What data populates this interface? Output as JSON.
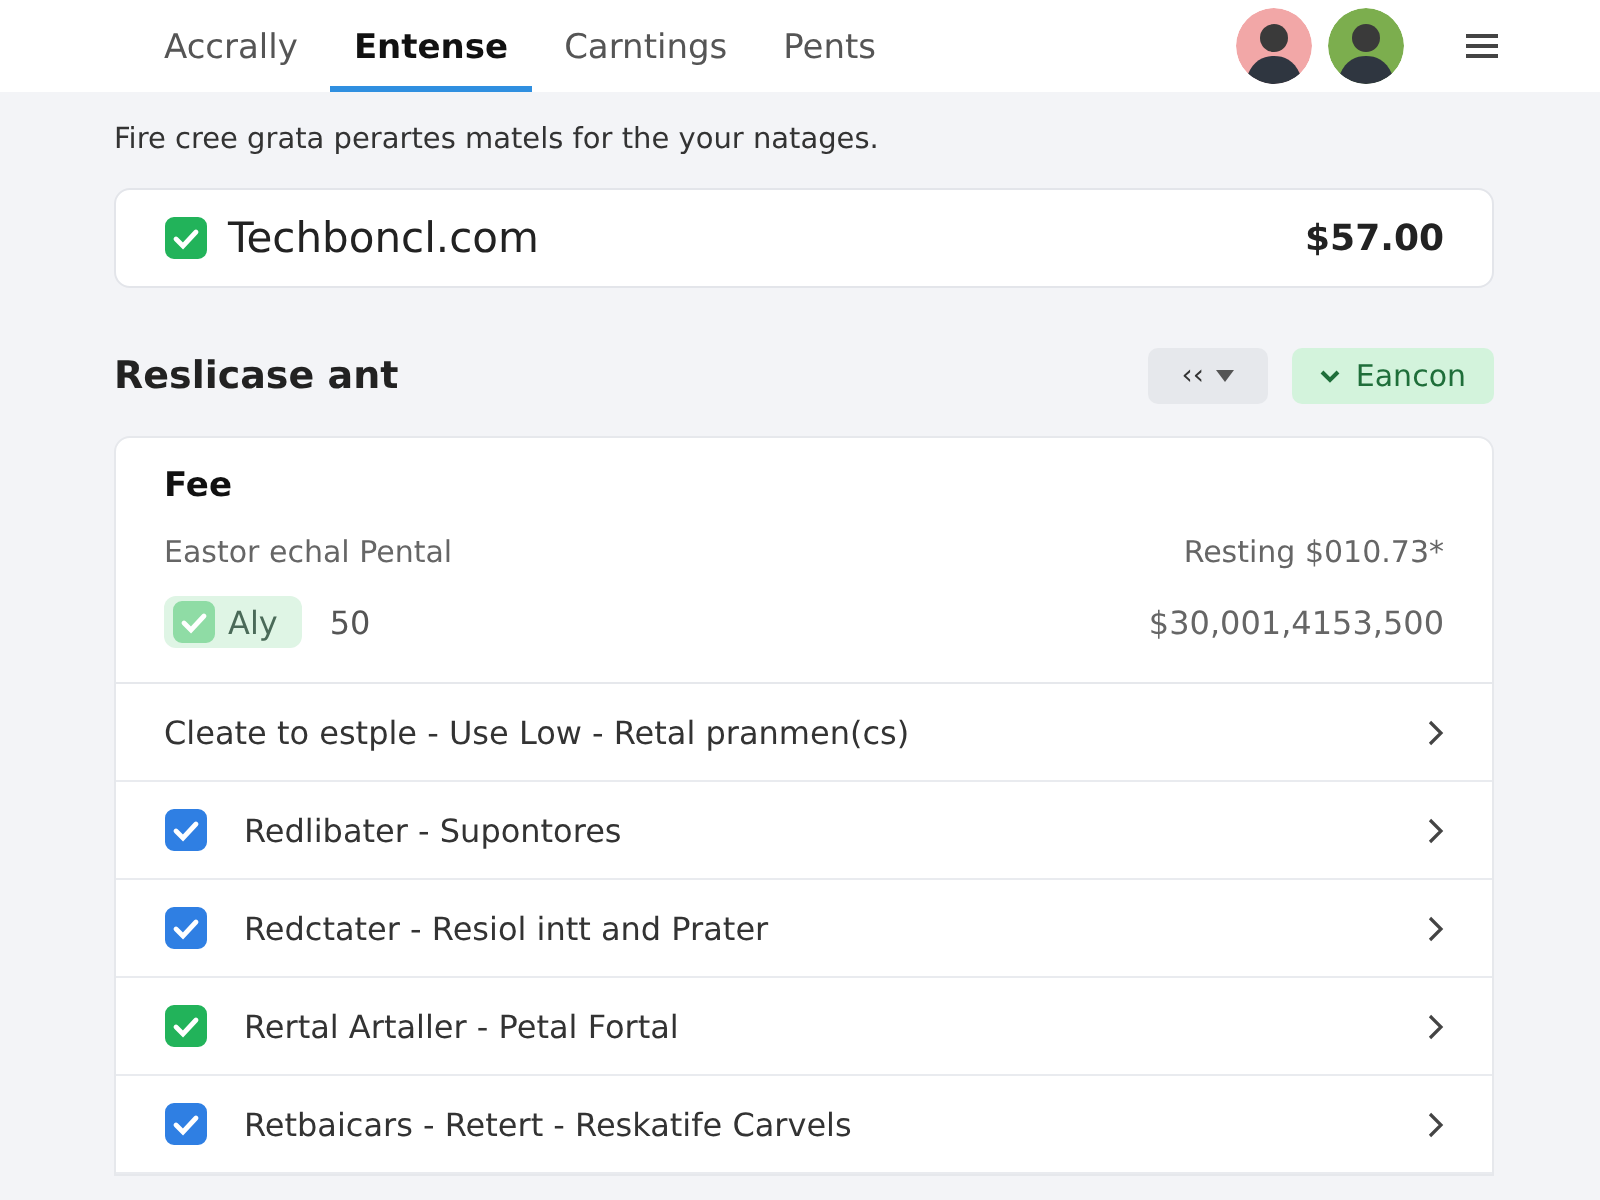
{
  "tabs": [
    {
      "label": "Accrally",
      "selected": false
    },
    {
      "label": "Entense",
      "selected": true
    },
    {
      "label": "Carntings",
      "selected": false
    },
    {
      "label": "Pents",
      "selected": false
    }
  ],
  "avatars": [
    {
      "color": "#f2a7a7"
    },
    {
      "color": "#7cae4e"
    }
  ],
  "subtitle": "Fire cree grata perartes matels for the your natages.",
  "domain_card": {
    "name": "Techboncl.com",
    "checked": true,
    "price": "$57.00"
  },
  "section": {
    "title": "Reslicase ant",
    "filter_button": {
      "icon": "‹‹"
    },
    "action_button": {
      "label": "Eancon"
    }
  },
  "fee": {
    "title": "Fee",
    "line": {
      "label": "Eastor echal Pental",
      "value": "Resting $010.73*"
    },
    "tag": {
      "label": "Aly",
      "checked": true,
      "count": "50",
      "value": "$30,001,4153,500"
    }
  },
  "items": [
    {
      "kind": "plain",
      "label": "Cleate to estple - Use Low - Retal pranmen(cs)"
    },
    {
      "kind": "check",
      "label": "Redlibater - Supontores",
      "checked": true,
      "color": "#2f7fe3"
    },
    {
      "kind": "check",
      "label": "Redctater - Resiol intt and Prater",
      "checked": true,
      "color": "#2f7fe3"
    },
    {
      "kind": "check",
      "label": "Rertal Artaller - Petal Fortal",
      "checked": true,
      "color": "#22b35a"
    },
    {
      "kind": "check",
      "label": "Retbaicars - Retert - Reskatife Carvels",
      "checked": true,
      "color": "#2f7fe3"
    }
  ]
}
